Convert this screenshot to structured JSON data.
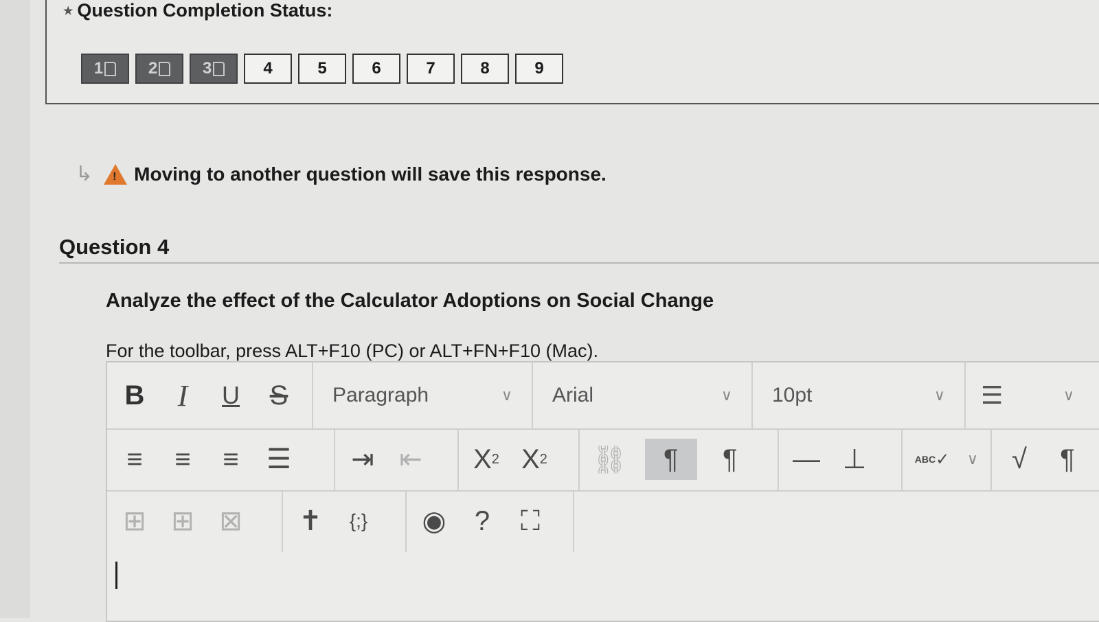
{
  "status": {
    "title": "Question Completion Status:",
    "questions": [
      {
        "label": "1",
        "answered": true
      },
      {
        "label": "2",
        "answered": true
      },
      {
        "label": "3",
        "answered": true
      },
      {
        "label": "4",
        "answered": false
      },
      {
        "label": "5",
        "answered": false
      },
      {
        "label": "6",
        "answered": false
      },
      {
        "label": "7",
        "answered": false
      },
      {
        "label": "8",
        "answered": false
      },
      {
        "label": "9",
        "answered": false
      }
    ]
  },
  "notice": {
    "text": "Moving to another question will save this response.",
    "warn_color": "#e0792e"
  },
  "question": {
    "heading": "Question 4",
    "prompt": "Analyze the effect of the Calculator Adoptions on Social Change",
    "toolbar_hint": "For the toolbar, press ALT+F10 (PC) or ALT+FN+F10 (Mac)."
  },
  "editor": {
    "format": {
      "bold": "B",
      "italic": "I",
      "underline": "U",
      "strike": "S"
    },
    "block_select": "Paragraph",
    "font_select": "Arial",
    "size_select": "10pt",
    "row2_icons": [
      "align-left-icon",
      "align-center-icon",
      "align-right-icon",
      "justify-icon",
      "indent-icon",
      "outdent-icon",
      "superscript-icon",
      "subscript-icon",
      "remove-link-icon",
      "ltr-icon",
      "rtl-icon",
      "horizontal-line-icon",
      "insert-icon",
      "spellcheck-icon",
      "math-icon",
      "paragraph-mark-icon"
    ],
    "superscript": {
      "base": "X",
      "mark": "2"
    },
    "subscript": {
      "base": "X",
      "mark": "2"
    },
    "spellcheck_label": "ABC"
  }
}
